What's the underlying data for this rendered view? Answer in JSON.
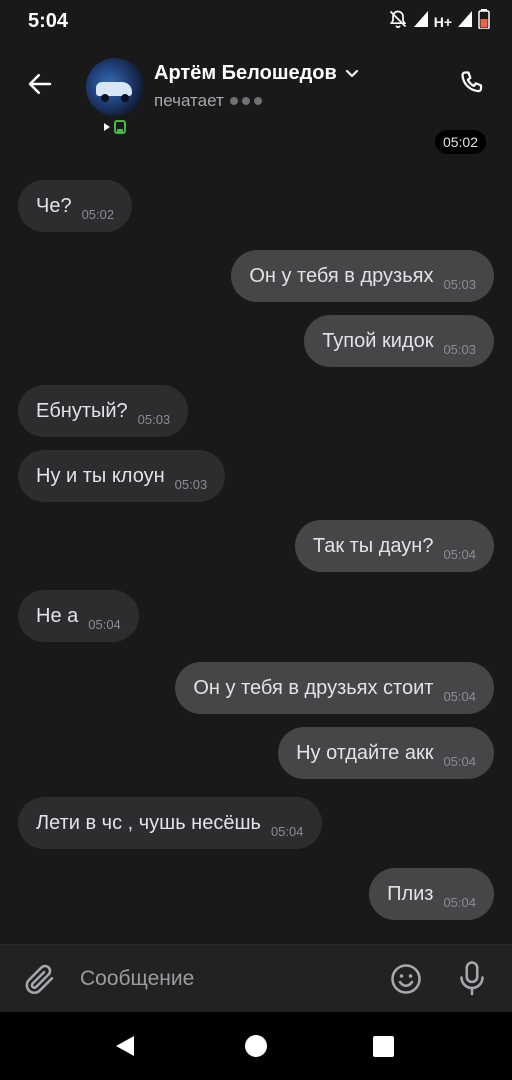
{
  "status_bar": {
    "time": "5:04",
    "network": "H+",
    "icons": [
      "mute-bell-icon",
      "signal-icon",
      "signal-icon",
      "battery-icon"
    ]
  },
  "header": {
    "back_icon": "arrow-left-icon",
    "contact_name": "Артём Белошедов",
    "status_text": "печатает",
    "call_icon": "phone-icon",
    "date_chip": "05:02"
  },
  "messages": [
    {
      "dir": "in",
      "text": "Че?",
      "time": "05:02"
    },
    {
      "dir": "out",
      "text": "Он у тебя в друзьях",
      "time": "05:03"
    },
    {
      "dir": "out",
      "text": "Тупой кидок",
      "time": "05:03"
    },
    {
      "dir": "in",
      "text": "Ебнутый?",
      "time": "05:03"
    },
    {
      "dir": "in",
      "text": "Ну и ты клоун",
      "time": "05:03"
    },
    {
      "dir": "out",
      "text": "Так ты даун?",
      "time": "05:04"
    },
    {
      "dir": "in",
      "text": "Не а",
      "time": "05:04"
    },
    {
      "dir": "out",
      "text": "Он у тебя в друзьях стоит",
      "time": "05:04"
    },
    {
      "dir": "out",
      "text": "Ну отдайте акк",
      "time": "05:04"
    },
    {
      "dir": "in",
      "text": "Лети в чс , чушь несёшь",
      "time": "05:04"
    },
    {
      "dir": "out",
      "text": "Плиз",
      "time": "05:04"
    }
  ],
  "composer": {
    "placeholder": "Сообщение",
    "icons": [
      "paperclip-icon",
      "emoji-icon",
      "microphone-icon"
    ]
  },
  "nav": {
    "icons": [
      "nav-back-icon",
      "nav-home-icon",
      "nav-recent-icon"
    ]
  },
  "colors": {
    "background": "#19191a",
    "incoming_bubble": "#2c2d2e",
    "outgoing_bubble": "#454647",
    "text": "#e1e3e6",
    "muted_text": "#8a8c90"
  }
}
